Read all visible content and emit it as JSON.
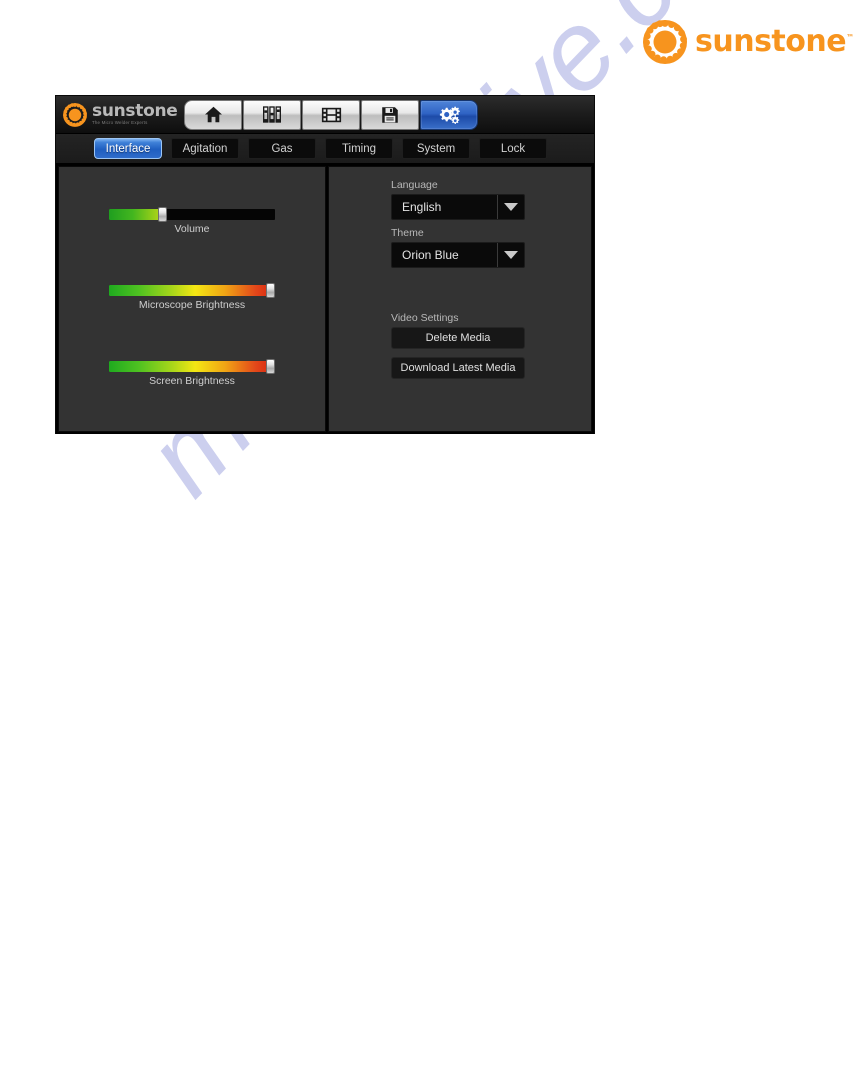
{
  "brand": {
    "name": "sunstone",
    "trademark": "™",
    "tagline": "The Micro Welder Experts",
    "accent_color": "#f7941e"
  },
  "watermark": {
    "text": "manualshive.com",
    "color": "#b9bde8"
  },
  "toolbar": {
    "buttons": [
      {
        "icon": "home-icon",
        "name": "home",
        "active": false
      },
      {
        "icon": "sliders-icon",
        "name": "weld-settings",
        "active": false
      },
      {
        "icon": "film-strip-icon",
        "name": "media",
        "active": false
      },
      {
        "icon": "floppy-disk-icon",
        "name": "save",
        "active": false
      },
      {
        "icon": "gears-icon",
        "name": "settings",
        "active": true
      }
    ],
    "active_color": "#2f63c4"
  },
  "tabs": [
    {
      "label": "Interface",
      "active": true
    },
    {
      "label": "Agitation",
      "active": false
    },
    {
      "label": "Gas",
      "active": false
    },
    {
      "label": "Timing",
      "active": false
    },
    {
      "label": "System",
      "active": false
    },
    {
      "label": "Lock",
      "active": false
    }
  ],
  "left_panel": {
    "sliders": [
      {
        "label": "Volume",
        "value": 32,
        "min": 0,
        "max": 100,
        "fill": "green"
      },
      {
        "label": "Microscope Brightness",
        "value": 100,
        "min": 0,
        "max": 100,
        "fill": "full"
      },
      {
        "label": "Screen Brightness",
        "value": 100,
        "min": 0,
        "max": 100,
        "fill": "full"
      }
    ]
  },
  "right_panel": {
    "language_label": "Language",
    "language_value": "English",
    "theme_label": "Theme",
    "theme_value": "Orion Blue",
    "video_settings_label": "Video Settings",
    "delete_media_label": "Delete Media",
    "download_media_label": "Download Latest Media"
  }
}
